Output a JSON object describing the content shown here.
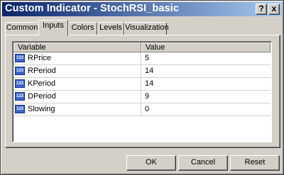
{
  "window": {
    "title": "Custom Indicator - StochRSI_basic",
    "help_label": "?",
    "close_label": "x"
  },
  "tabs": [
    {
      "label": "Common"
    },
    {
      "label": "Inputs",
      "active": true
    },
    {
      "label": "Colors"
    },
    {
      "label": "Levels"
    },
    {
      "label": "Visualization"
    }
  ],
  "grid": {
    "columns": [
      "Variable",
      "Value"
    ],
    "row_icon": "123",
    "rows": [
      {
        "variable": "RPrice",
        "value": "5"
      },
      {
        "variable": "RPeriod",
        "value": "14"
      },
      {
        "variable": "KPeriod",
        "value": "14"
      },
      {
        "variable": "DPeriod",
        "value": "9"
      },
      {
        "variable": "Slowing",
        "value": "0"
      }
    ]
  },
  "buttons": {
    "ok": "OK",
    "cancel": "Cancel",
    "reset": "Reset"
  }
}
